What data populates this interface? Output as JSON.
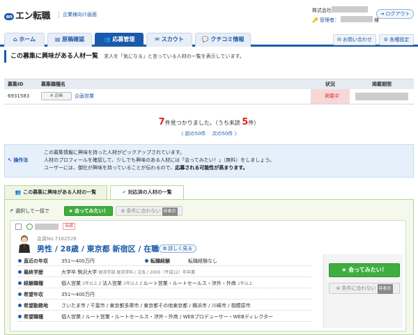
{
  "header": {
    "logo": "エン転職",
    "logo_mark": "en",
    "subtitle": "企業様向け画面",
    "company_label": "株式会社",
    "manager_label": "管理者：",
    "manager_suffix": "様",
    "logout": "ログアウト"
  },
  "nav": {
    "tabs": [
      {
        "label": "ホーム",
        "icon": "home-icon"
      },
      {
        "label": "原稿確認",
        "icon": "document-icon"
      },
      {
        "label": "応募管理",
        "icon": "users-icon",
        "active": true
      },
      {
        "label": "スカウト",
        "icon": "mail-icon"
      },
      {
        "label": "クチコミ情報",
        "icon": "chat-icon"
      }
    ],
    "contact": "お問い合わせ",
    "settings": "各種設定"
  },
  "page": {
    "title": "この募集に興味がある人材一覧",
    "description": "求人を「気になる」と言っている人材の一覧を表示しています。"
  },
  "job_table": {
    "headers": [
      "募集ID",
      "募集職種名",
      "状況",
      "掲載期間"
    ],
    "row": {
      "id": "6931583",
      "type_button": "A 企画",
      "name": "企画営業",
      "status": "掲載中"
    }
  },
  "results": {
    "count": "7",
    "found_text": "件見つかりました。（うち未読",
    "unread": "5",
    "unread_suffix": "件）",
    "prev": "〈 前の50件",
    "next": "次の50件 〉"
  },
  "info": {
    "label": "操作法",
    "line1": "この募集情報に興味を持った人材がピックアップされています。",
    "line2": "人材のプロフィールを確認して、少しでも興味のある人材には「会ってみたい！」（無料）をしましょう。",
    "line3a": "ユーザーには、御社が興味を持っていることが伝わるので、",
    "line3b": "応募される可能性が高まります。"
  },
  "list_tabs": {
    "active": "この募集に興味がある人材の一覧",
    "inactive": "対応済の人材の一覧"
  },
  "bulk": {
    "label": "↱ 選択して一括で",
    "meet": "★ 会ってみたい！",
    "no_match": "⊗ 条件に合わない",
    "hidden": "非表示"
  },
  "candidate": {
    "unread": "未読",
    "member_no": "会員No.7162526",
    "profile": "男性 / 28歳 / 東京都 新宿区 / 在職中",
    "detail": "⧉ 詳しく見る",
    "attrs": [
      {
        "key": "直近の年収",
        "value": "351～400万円",
        "key2": "転職経験",
        "value2": "転職経験なし"
      },
      {
        "key": "最終学歴",
        "value": "大学卒 駒沢大学",
        "note": "経済学部 経済学科 / 文系 / 2000（平成12）年卒業"
      },
      {
        "key": "経験職種",
        "value": "個人営業",
        "note1": "2年以上",
        "value_b": " / 法人営業",
        "note2": "2年以上",
        "value_c": " / ルート営業・ルートセールス・渉外・外商",
        "note3": "1年以上"
      },
      {
        "key": "希望年収",
        "value": "351～400万円"
      },
      {
        "key": "希望勤務地",
        "value": "さいたま市 / 千葉市 / 東京都多摩市 / 東京都その他東京都 / 横浜市 / 川崎市 / 相模原市"
      },
      {
        "key": "希望職種",
        "value": "個人営業 / ルート営業・ルートセールス・渉外・外商 / WEBプロデューサー・WEBディレクター"
      }
    ],
    "meet_button": "★ 会ってみたい！",
    "no_match_button": "⊗ 条件に合わない",
    "hidden": "非表示"
  }
}
